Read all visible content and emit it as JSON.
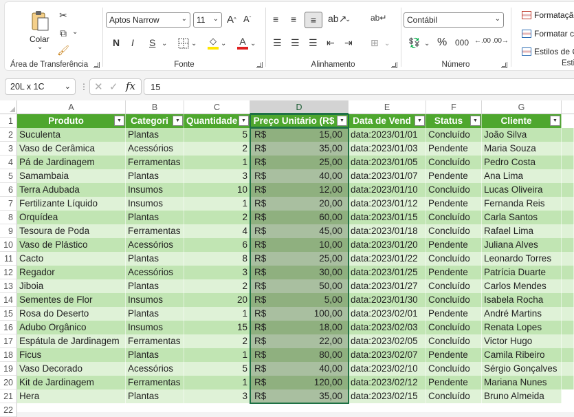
{
  "ribbon": {
    "clipboard": {
      "paste_label": "Colar",
      "group_label": "Área de Transferência"
    },
    "font": {
      "font_name": "Aptos Narrow",
      "font_size": "11",
      "bold": "N",
      "italic": "I",
      "underline": "S",
      "group_label": "Fonte",
      "font_color": "#e02020",
      "fill_color": "#ffe600"
    },
    "alignment": {
      "group_label": "Alinhamento"
    },
    "number": {
      "format": "Contábil",
      "group_label": "Número"
    },
    "styles": {
      "cond_format": "Formatação",
      "format_as_table": "Formatar co",
      "cell_styles": "Estilos de Ce",
      "group_label": "Esti"
    }
  },
  "formula_bar": {
    "name_box": "20L x 1C",
    "formula": "15",
    "fx": "fx"
  },
  "columns": [
    "A",
    "B",
    "C",
    "D",
    "E",
    "F",
    "G"
  ],
  "table": {
    "headers": [
      "Produto",
      "Categori",
      "Quantidade",
      "Preço Unitário (R$",
      "Data de Vend",
      "Status",
      "Cliente"
    ],
    "currency": "R$",
    "rows": [
      [
        "Suculenta",
        "Plantas",
        "5",
        "15,00",
        "data:2023/01/01",
        "Concluído",
        "João Silva"
      ],
      [
        "Vaso de Cerâmica",
        "Acessórios",
        "2",
        "35,00",
        "data:2023/01/03",
        "Pendente",
        "Maria Souza"
      ],
      [
        "Pá de Jardinagem",
        "Ferramentas",
        "1",
        "25,00",
        "data:2023/01/05",
        "Concluído",
        "Pedro Costa"
      ],
      [
        "Samambaia",
        "Plantas",
        "3",
        "40,00",
        "data:2023/01/07",
        "Pendente",
        "Ana Lima"
      ],
      [
        "Terra Adubada",
        "Insumos",
        "10",
        "12,00",
        "data:2023/01/10",
        "Concluído",
        "Lucas Oliveira"
      ],
      [
        "Fertilizante Líquido",
        "Insumos",
        "1",
        "20,00",
        "data:2023/01/12",
        "Pendente",
        "Fernanda Reis"
      ],
      [
        "Orquídea",
        "Plantas",
        "2",
        "60,00",
        "data:2023/01/15",
        "Concluído",
        "Carla Santos"
      ],
      [
        "Tesoura de Poda",
        "Ferramentas",
        "4",
        "45,00",
        "data:2023/01/18",
        "Concluído",
        "Rafael Lima"
      ],
      [
        "Vaso de Plástico",
        "Acessórios",
        "6",
        "10,00",
        "data:2023/01/20",
        "Pendente",
        "Juliana Alves"
      ],
      [
        "Cacto",
        "Plantas",
        "8",
        "25,00",
        "data:2023/01/22",
        "Concluído",
        "Leonardo Torres"
      ],
      [
        "Regador",
        "Acessórios",
        "3",
        "30,00",
        "data:2023/01/25",
        "Pendente",
        "Patrícia Duarte"
      ],
      [
        "Jiboia",
        "Plantas",
        "2",
        "50,00",
        "data:2023/01/27",
        "Concluído",
        "Carlos Mendes"
      ],
      [
        "Sementes de Flor",
        "Insumos",
        "20",
        "5,00",
        "data:2023/01/30",
        "Concluído",
        "Isabela Rocha"
      ],
      [
        "Rosa do Deserto",
        "Plantas",
        "1",
        "100,00",
        "data:2023/02/01",
        "Pendente",
        "André Martins"
      ],
      [
        "Adubo Orgânico",
        "Insumos",
        "15",
        "18,00",
        "data:2023/02/03",
        "Concluído",
        "Renata Lopes"
      ],
      [
        "Espátula de Jardinagem",
        "Ferramentas",
        "2",
        "22,00",
        "data:2023/02/05",
        "Concluído",
        "Victor Hugo"
      ],
      [
        "Ficus",
        "Plantas",
        "1",
        "80,00",
        "data:2023/02/07",
        "Pendente",
        "Camila Ribeiro"
      ],
      [
        "Vaso Decorado",
        "Acessórios",
        "5",
        "40,00",
        "data:2023/02/10",
        "Concluído",
        "Sérgio Gonçalves"
      ],
      [
        "Kit de Jardinagem",
        "Ferramentas",
        "1",
        "120,00",
        "data:2023/02/12",
        "Pendente",
        "Mariana Nunes"
      ],
      [
        "Hera",
        "Plantas",
        "3",
        "35,00",
        "data:2023/02/15",
        "Concluído",
        "Bruno Almeida"
      ]
    ]
  },
  "colors": {
    "header_green": "#4ea72e",
    "band_dark": "#c1e5b3",
    "band_light": "#dff2d7",
    "selection": "#1e7145"
  }
}
